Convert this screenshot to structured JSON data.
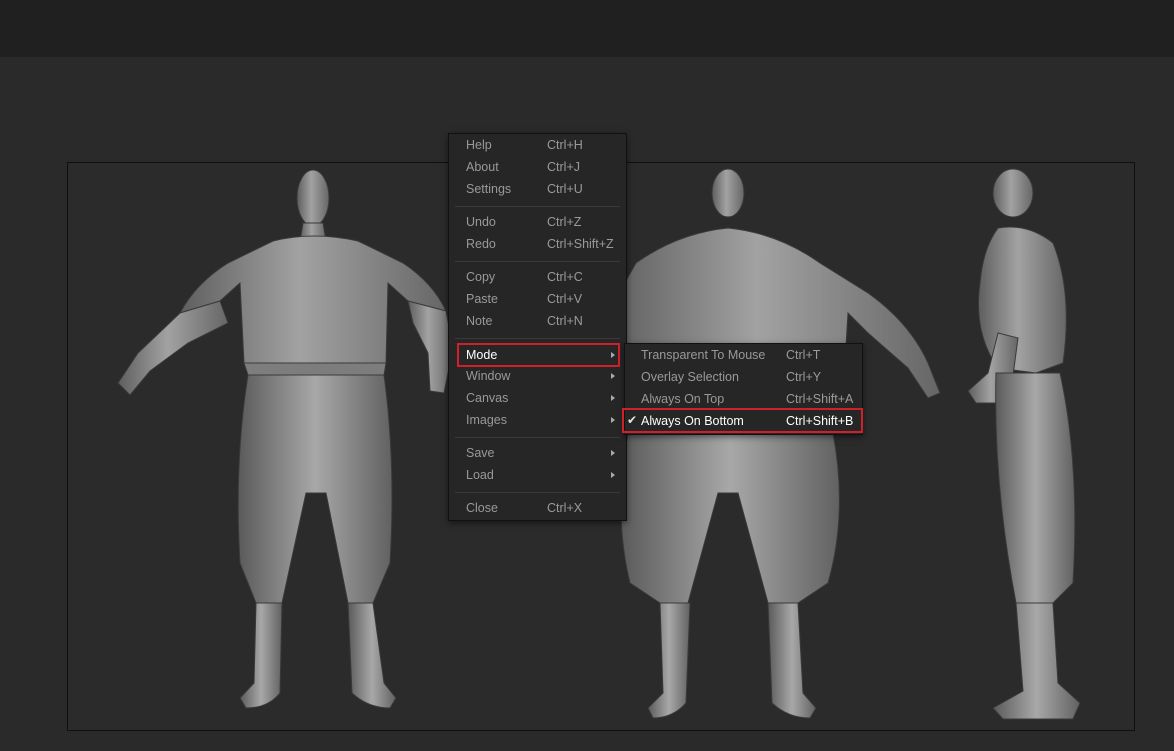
{
  "main_menu": {
    "groups": [
      [
        {
          "label": "Help",
          "shortcut": "Ctrl+H"
        },
        {
          "label": "About",
          "shortcut": "Ctrl+J"
        },
        {
          "label": "Settings",
          "shortcut": "Ctrl+U"
        }
      ],
      [
        {
          "label": "Undo",
          "shortcut": "Ctrl+Z"
        },
        {
          "label": "Redo",
          "shortcut": "Ctrl+Shift+Z"
        }
      ],
      [
        {
          "label": "Copy",
          "shortcut": "Ctrl+C"
        },
        {
          "label": "Paste",
          "shortcut": "Ctrl+V"
        },
        {
          "label": "Note",
          "shortcut": "Ctrl+N"
        }
      ],
      [
        {
          "label": "Mode",
          "submenu": true,
          "highlighted": true
        },
        {
          "label": "Window",
          "submenu": true
        },
        {
          "label": "Canvas",
          "submenu": true
        },
        {
          "label": "Images",
          "submenu": true
        }
      ],
      [
        {
          "label": "Save",
          "submenu": true
        },
        {
          "label": "Load",
          "submenu": true
        }
      ],
      [
        {
          "label": "Close",
          "shortcut": "Ctrl+X"
        }
      ]
    ]
  },
  "mode_submenu": {
    "items": [
      {
        "label": "Transparent To Mouse",
        "shortcut": "Ctrl+T"
      },
      {
        "label": "Overlay Selection",
        "shortcut": "Ctrl+Y"
      },
      {
        "label": "Always On Top",
        "shortcut": "Ctrl+Shift+A"
      },
      {
        "label": "Always On Bottom",
        "shortcut": "Ctrl+Shift+B",
        "checked": true,
        "highlighted": true
      }
    ]
  },
  "colors": {
    "highlight_border": "#d0202a",
    "menu_bg": "#262626",
    "canvas_bg": "#2b2b2b",
    "model_gray": "#8a8a8a"
  }
}
